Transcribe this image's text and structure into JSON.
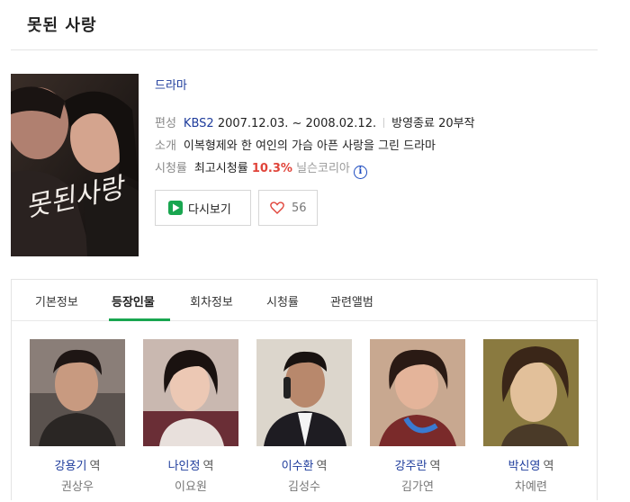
{
  "header": {
    "title": "못된 사랑"
  },
  "poster": {
    "alt": "poster-image"
  },
  "info": {
    "genre": "드라마",
    "broadcast_label": "편성",
    "network": "KBS2",
    "period": "2007.12.03. ~ 2008.02.12.",
    "status": "방영종료 20부작",
    "summary_label": "소개",
    "summary": "이복형제와 한 여인의 가슴 아픈 사랑을 그린 드라마",
    "rating_label": "시청률",
    "rating_type": "최고시청률",
    "rating_value": "10.3%",
    "rating_source": "닐슨코리아",
    "info_icon": "i"
  },
  "buttons": {
    "watch_label": "다시보기",
    "like_count": "56"
  },
  "tabs": [
    {
      "label": "기본정보"
    },
    {
      "label": "등장인물"
    },
    {
      "label": "회차정보"
    },
    {
      "label": "시청률"
    },
    {
      "label": "관련앨범"
    }
  ],
  "active_tab": "등장인물",
  "cast": [
    {
      "role": "강용기",
      "suffix": "역",
      "actor": "권상우"
    },
    {
      "role": "나인정",
      "suffix": "역",
      "actor": "이요원"
    },
    {
      "role": "이수환",
      "suffix": "역",
      "actor": "김성수"
    },
    {
      "role": "강주란",
      "suffix": "역",
      "actor": "김가연"
    },
    {
      "role": "박신영",
      "suffix": "역",
      "actor": "차예련"
    }
  ],
  "colors": {
    "link": "#1e3c9c",
    "accent_green": "#19a650",
    "rating_red": "#e0443a"
  }
}
